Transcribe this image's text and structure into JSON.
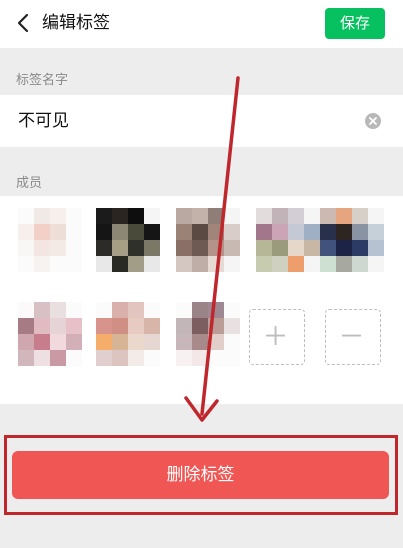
{
  "header": {
    "title": "编辑标签",
    "back_icon": "chevron-left-icon",
    "save_label": "保存",
    "save_color": "#07c160"
  },
  "name_section": {
    "label": "标签名字",
    "value": "不可见",
    "clear_icon": "clear-circle-icon"
  },
  "members_section": {
    "label": "成员",
    "members": [
      {
        "name": "member-1",
        "colors": [
          "#fbfbfb",
          "#f1e9e6",
          "#f6efec",
          "#fbfbfb",
          "#f7efec",
          "#f2cfc7",
          "#eeded8",
          "#fbfbfb",
          "#f9f7f5",
          "#f3e6e2",
          "#f3e9e5",
          "#fbfbfb",
          "#fbfbfb",
          "#f6f3f1",
          "#fbfbfb",
          "#fbfbfb"
        ]
      },
      {
        "name": "member-2",
        "colors": [
          "#1b1b1b",
          "#2a2520",
          "#0e0e0e",
          "#f5f5f5",
          "#151515",
          "#8c8775",
          "#4a4a3a",
          "#151515",
          "#2c2b28",
          "#a69f85",
          "#30302a",
          "#7b7866",
          "#e8e8e8",
          "#2a2a24",
          "#a29d86",
          "#e8e8e8"
        ]
      },
      {
        "name": "member-3",
        "colors": [
          "#b9a9a2",
          "#c3b2aa",
          "#8f7e77",
          "#f5f5f5",
          "#9b8277",
          "#5b4a43",
          "#a2857a",
          "#d8cdc8",
          "#8a6f66",
          "#6e5a53",
          "#b49389",
          "#c8b9b3",
          "#d4c7c2",
          "#bfaea7",
          "#e6dad5",
          "#f5f5f5"
        ]
      },
      {
        "name": "member-4",
        "colors": [
          "#e2dcdc",
          "#c2b3b8",
          "#d3ced6",
          "#f5f5f5",
          "#a2778c",
          "#cba4b6",
          "#c5c8d5",
          "#9fb0c4",
          "#b5b797",
          "#9a9a7c",
          "#e6d7cb",
          "#c9b7a6",
          "#c7cbb0",
          "#d0d0c0",
          "#ee9d6d",
          "#f5f5f5"
        ]
      },
      {
        "name": "member-5",
        "colors": [
          "#ccb9b1",
          "#e6a57f",
          "#d6d0c9",
          "#f5f5f5",
          "#28304c",
          "#2d2522",
          "#8a93a3",
          "#c6d0d9",
          "#41537d",
          "#1c2344",
          "#2c3a66",
          "#b6c2d2",
          "#cde0d2",
          "#a7a9a1",
          "#cfd7d1",
          "#f5f5f5"
        ]
      },
      {
        "name": "member-6",
        "colors": [
          "#fbf9f9",
          "#d7c1c4",
          "#e9dfe0",
          "#fbfbfb",
          "#a77b83",
          "#e0bcc2",
          "#e6d3d7",
          "#e7c0c8",
          "#cfa7ae",
          "#c77d8b",
          "#f1d9de",
          "#d3b0b7",
          "#d1b7bb",
          "#eedfe2",
          "#c99aa3",
          "#fbfbfb"
        ]
      },
      {
        "name": "member-7",
        "colors": [
          "#fbfbfb",
          "#d9b0ab",
          "#e2c5be",
          "#fbfbfb",
          "#d8938c",
          "#cf8f84",
          "#e7cbc3",
          "#d7b6a9",
          "#f5ad6b",
          "#d8b497",
          "#ead8cd",
          "#e7d7d3",
          "#e1cfd0",
          "#dcc4c0",
          "#f3ebe8",
          "#fbfbfb"
        ]
      },
      {
        "name": "member-8",
        "colors": [
          "#fbfbfb",
          "#9a8487",
          "#9e8891",
          "#fbfbfb",
          "#c3b6b9",
          "#7c5d60",
          "#bb9d98",
          "#e9e1e1",
          "#c7b7bb",
          "#a88a8a",
          "#e2cfc9",
          "#fbfbfb",
          "#f7f1f2",
          "#f3e7e8",
          "#fbfbfb",
          "#fbfbfb"
        ]
      }
    ],
    "add_icon": "plus-icon",
    "remove_icon": "minus-icon"
  },
  "delete_label": "删除标签",
  "colors": {
    "delete_button": "#f05653",
    "annotation": "#c0272d"
  }
}
